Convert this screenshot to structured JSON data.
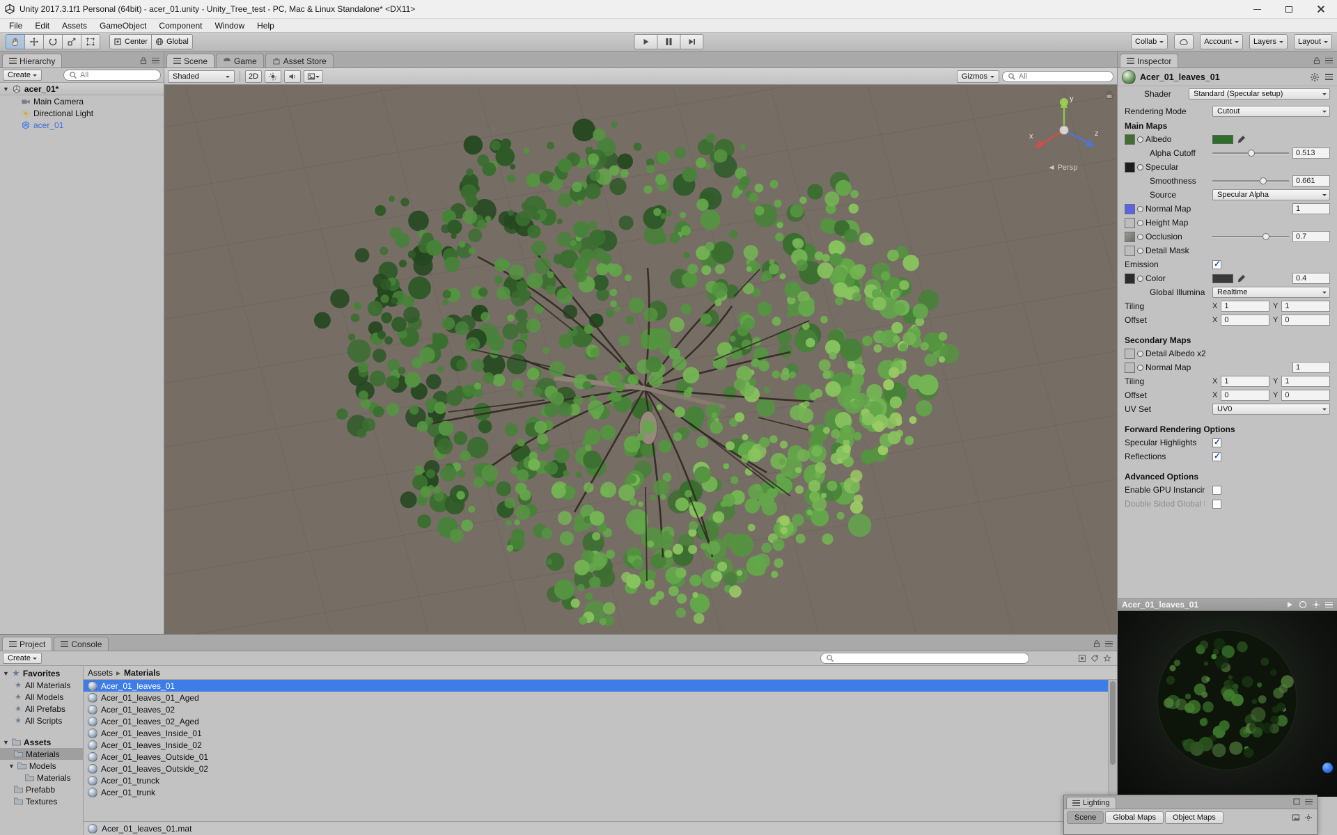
{
  "window": {
    "title": "Unity 2017.3.1f1 Personal (64bit) - acer_01.unity - Unity_Tree_test - PC, Mac & Linux Standalone* <DX11>"
  },
  "menu": {
    "items": [
      "File",
      "Edit",
      "Assets",
      "GameObject",
      "Component",
      "Window",
      "Help"
    ]
  },
  "toolbar": {
    "pivot": "Center",
    "space": "Global",
    "collab": "Collab",
    "account": "Account",
    "layers": "Layers",
    "layout": "Layout"
  },
  "hierarchy": {
    "title": "Hierarchy",
    "create": "Create",
    "search_filter": "All",
    "scene_name": "acer_01*",
    "items": [
      {
        "label": "Main Camera"
      },
      {
        "label": "Directional Light"
      },
      {
        "label": "acer_01"
      }
    ]
  },
  "scene_view": {
    "tab_scene": "Scene",
    "tab_game": "Game",
    "tab_asset_store": "Asset Store",
    "draw_mode": "Shaded",
    "toggle_2d": "2D",
    "gizmos": "Gizmos",
    "search_filter": "All",
    "projection": "Persp",
    "axis_x": "x",
    "axis_y": "y",
    "axis_z": "z"
  },
  "inspector": {
    "title": "Inspector",
    "material_name": "Acer_01_leaves_01",
    "shader_label": "Shader",
    "shader_value": "Standard (Specular setup)",
    "rendering_mode_label": "Rendering Mode",
    "rendering_mode_value": "Cutout",
    "main_maps": {
      "header": "Main Maps",
      "albedo": "Albedo",
      "alpha_cutoff": "Alpha Cutoff",
      "alpha_cutoff_value": "0.513",
      "specular": "Specular",
      "smoothness": "Smoothness",
      "smoothness_value": "0.661",
      "source": "Source",
      "source_value": "Specular Alpha",
      "normal_map": "Normal Map",
      "normal_map_value": "1",
      "height_map": "Height Map",
      "occlusion": "Occlusion",
      "occlusion_value": "0.7",
      "detail_mask": "Detail Mask",
      "emission": "Emission",
      "color": "Color",
      "emission_value": "0.4",
      "global_illumination": "Global Illumination",
      "global_illumination_value": "Realtime",
      "tiling": "Tiling",
      "offset": "Offset",
      "x": "X",
      "y": "Y",
      "tiling_x": "1",
      "tiling_y": "1",
      "offset_x": "0",
      "offset_y": "0"
    },
    "secondary_maps": {
      "header": "Secondary Maps",
      "detail_albedo": "Detail Albedo x2",
      "normal_map": "Normal Map",
      "normal_map_value": "1",
      "tiling": "Tiling",
      "offset": "Offset",
      "x": "X",
      "y": "Y",
      "tiling_x": "1",
      "tiling_y": "1",
      "offset_x": "0",
      "offset_y": "0",
      "uv_set": "UV Set",
      "uv_set_value": "UV0"
    },
    "forward_rendering": {
      "header": "Forward Rendering Options",
      "specular_highlights": "Specular Highlights",
      "reflections": "Reflections"
    },
    "advanced": {
      "header": "Advanced Options",
      "gpu_instancing": "Enable GPU Instancing",
      "double_sided_gi": "Double Sided Global Illumination"
    },
    "preview_title": "Acer_01_leaves_01"
  },
  "project": {
    "tab_project": "Project",
    "tab_console": "Console",
    "create": "Create",
    "favorites_header": "Favorites",
    "favorites": [
      {
        "label": "All Materials"
      },
      {
        "label": "All Models"
      },
      {
        "label": "All Prefabs"
      },
      {
        "label": "All Scripts"
      }
    ],
    "assets_header": "Assets",
    "folders": [
      {
        "label": "Materials"
      },
      {
        "label": "Models"
      },
      {
        "label": "Materials"
      },
      {
        "label": "Prefabb"
      },
      {
        "label": "Textures"
      }
    ],
    "breadcrumb_root": "Assets",
    "breadcrumb_current": "Materials",
    "files": [
      {
        "label": "Acer_01_leaves_01"
      },
      {
        "label": "Acer_01_leaves_01_Aged"
      },
      {
        "label": "Acer_01_leaves_02"
      },
      {
        "label": "Acer_01_leaves_02_Aged"
      },
      {
        "label": "Acer_01_leaves_Inside_01"
      },
      {
        "label": "Acer_01_leaves_Inside_02"
      },
      {
        "label": "Acer_01_leaves_Outside_01"
      },
      {
        "label": "Acer_01_leaves_Outside_02"
      },
      {
        "label": "Acer_01_trunck"
      },
      {
        "label": "Acer_01_trunk"
      }
    ],
    "status": "Acer_01_leaves_01.mat"
  },
  "lighting": {
    "title": "Lighting",
    "tab_scene": "Scene",
    "tab_global": "Global Maps",
    "tab_object": "Object Maps"
  },
  "colors": {
    "selection_blue": "#3e7de7",
    "prefab_text": "#3b6dd6",
    "scene_background": "#766d64",
    "albedo_swatch": "#2d6e28",
    "normal_map_swatch": "#5a63e0",
    "emission_color_swatch": "#3a3a3a"
  }
}
